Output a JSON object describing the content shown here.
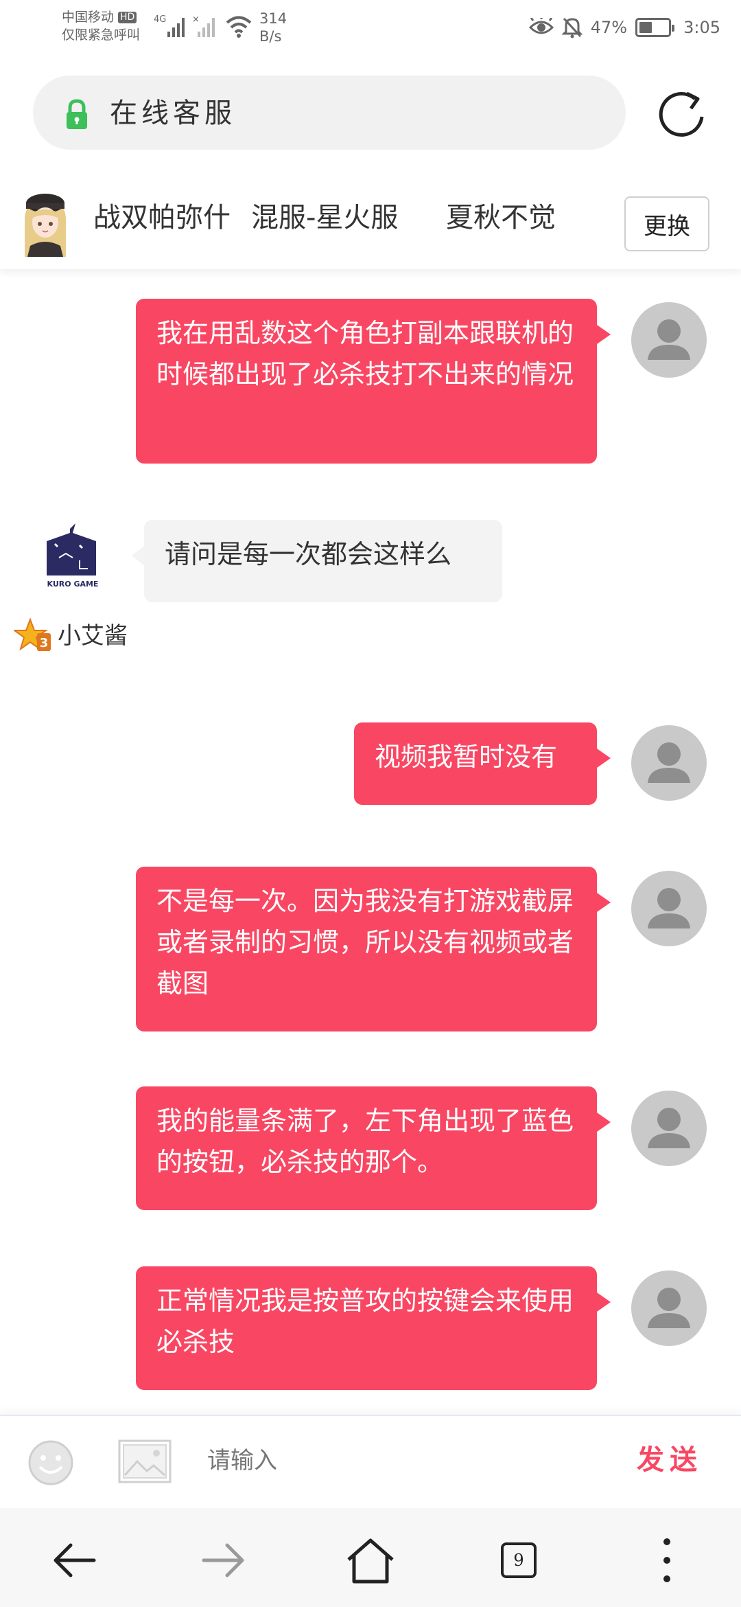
{
  "status_bar": {
    "carrier_line1": "中国移动",
    "hd": "HD",
    "carrier_line2": "仅限紧急呼叫",
    "network": "4G",
    "speed_value": "314",
    "speed_unit": "B/s",
    "battery": "47%",
    "time": "3:05"
  },
  "address_bar": {
    "title": "在线客服"
  },
  "user_header": {
    "game": "战双帕弥什",
    "server": "混服-星火服",
    "player": "夏秋不觉",
    "change_label": "更换"
  },
  "chat": {
    "messages": [
      {
        "side": "user",
        "text": "我在用乱数这个角色打副本跟联机的时候都出现了必杀技打不出来的情况"
      },
      {
        "side": "agent",
        "text": "请问是每一次都会这样么",
        "agent_name": "小艾酱",
        "logo_text": "KURO GAME"
      },
      {
        "side": "user",
        "text": "视频我暂时没有"
      },
      {
        "side": "user",
        "text": "不是每一次。因为我没有打游戏截屏或者录制的习惯，所以没有视频或者截图"
      },
      {
        "side": "user",
        "text": "我的能量条满了，左下角出现了蓝色的按钮，必杀技的那个。"
      },
      {
        "side": "user",
        "text": "正常情况我是按普攻的按键会来使用必杀技"
      }
    ]
  },
  "input_bar": {
    "placeholder": "请输入",
    "send_label": "发送"
  },
  "bottom_nav": {
    "tab_count": "9"
  },
  "icons": {
    "lock": "lock-icon",
    "refresh": "refresh-icon",
    "emoji": "emoji-icon",
    "image": "image-icon",
    "back": "back-arrow-icon",
    "forward": "forward-arrow-icon",
    "home": "home-icon",
    "more": "more-vertical-icon"
  },
  "colors": {
    "bubble_user": "#f94763",
    "bubble_agent": "#f3f3f3",
    "send": "#f94763",
    "lock": "#3dbf5a"
  }
}
